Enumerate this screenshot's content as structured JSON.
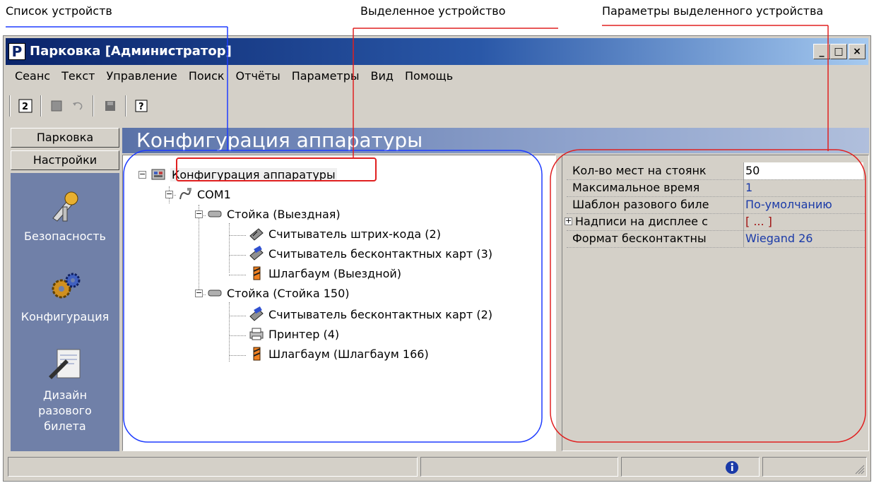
{
  "annotations": {
    "device_list": "Список устройств",
    "selected_device": "Выделенное устройство",
    "selected_device_params": "Параметры выделенного устройства"
  },
  "window": {
    "app_icon_letter": "P",
    "title": "Парковка [Администратор]",
    "controls": {
      "minimize": "_",
      "maximize": "□",
      "close": "×"
    }
  },
  "menu": [
    "Сеанс",
    "Текст",
    "Управление",
    "Поиск",
    "Отчёты",
    "Параметры",
    "Вид",
    "Помощь"
  ],
  "left_panel": {
    "tab_parking": "Парковка",
    "tab_settings": "Настройки",
    "nav": [
      {
        "label": "Безопасность",
        "icon": "security-icon"
      },
      {
        "label": "Конфигурация",
        "icon": "configuration-icon"
      },
      {
        "label": "Дизайн разового билета",
        "icon": "ticket-design-icon"
      }
    ]
  },
  "header": {
    "title": "Конфигурация аппаратуры"
  },
  "tree": {
    "root": "Конфигурация аппаратуры",
    "port": "COM1",
    "stand1": "Стойка (Выездная)",
    "stand1_items": [
      "Считыватель штрих-кода (2)",
      "Считыватель бесконтактных карт (3)",
      "Шлагбаум (Выездной)"
    ],
    "stand2": "Стойка (Стойка 150)",
    "stand2_items": [
      "Считыватель бесконтактных карт (2)",
      "Принтер (4)",
      "Шлагбаум (Шлагбаум 166)"
    ]
  },
  "properties": [
    {
      "name": "Кол-во мест на стоянк",
      "value": "50",
      "value_color": "#000000",
      "expandable": false
    },
    {
      "name": "Максимальное время",
      "value": "1",
      "value_color": "#1a3aa8",
      "expandable": false
    },
    {
      "name": "Шаблон разового биле",
      "value": "По-умолчанию",
      "value_color": "#1a3aa8",
      "expandable": false
    },
    {
      "name": "Надписи на дисплее с",
      "value": "[ ... ]",
      "value_color": "#a01010",
      "expandable": true
    },
    {
      "name": "Формат бесконтактны",
      "value": "Wiegand 26",
      "value_color": "#1a3aa8",
      "expandable": false
    }
  ],
  "colors": {
    "title_bar": "#0a246a",
    "header": "#5a72a8",
    "nav_bg": "#7080a8",
    "tree_box": "#1e3cff",
    "callout_red": "#e02020"
  }
}
